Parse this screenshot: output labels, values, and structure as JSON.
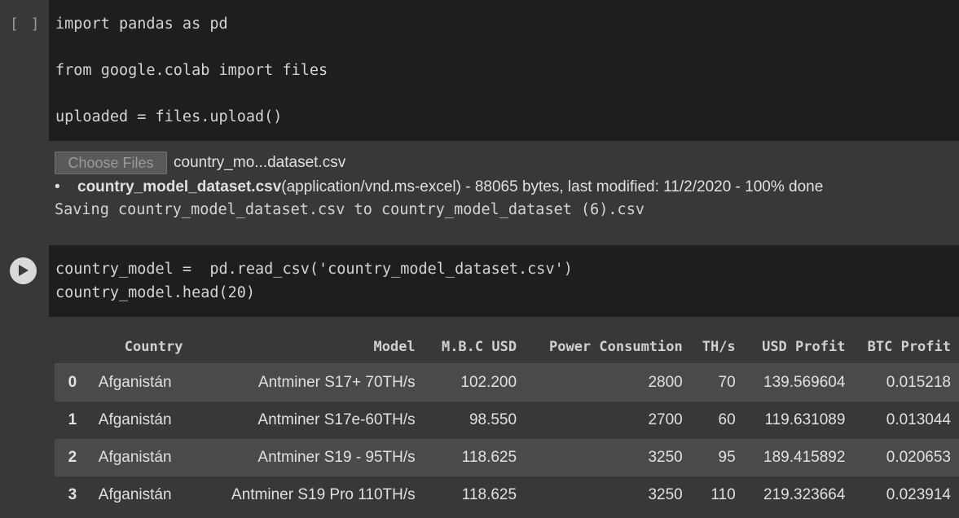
{
  "cell1": {
    "brackets": "[ ]",
    "lines": [
      "import pandas as pd",
      "from google.colab import files",
      "uploaded = files.upload()"
    ]
  },
  "upload_output": {
    "choose_button": "Choose Files",
    "selected_file": "country_mo...dataset.csv",
    "file_name": "country_model_dataset.csv",
    "file_details": "(application/vnd.ms-excel) - 88065 bytes, last modified: 11/2/2020 - 100% done",
    "saving_message": "Saving country_model_dataset.csv to country_model_dataset (6).csv"
  },
  "cell2": {
    "lines": [
      "country_model =  pd.read_csv('country_model_dataset.csv')",
      "country_model.head(20)"
    ]
  },
  "dataframe": {
    "columns": [
      "",
      "Country",
      "Model",
      "M.B.C USD",
      "Power Consumtion",
      "TH/s",
      "USD Profit",
      "BTC Profit"
    ],
    "rows": [
      [
        "0",
        "Afganistán",
        "Antminer S17+ 70TH/s",
        "102.200",
        "2800",
        "70",
        "139.569604",
        "0.015218"
      ],
      [
        "1",
        "Afganistán",
        "Antminer S17e-60TH/s",
        "98.550",
        "2700",
        "60",
        "119.631089",
        "0.013044"
      ],
      [
        "2",
        "Afganistán",
        "Antminer S19 - 95TH/s",
        "118.625",
        "3250",
        "95",
        "189.415892",
        "0.020653"
      ],
      [
        "3",
        "Afganistán",
        "Antminer S19 Pro 110TH/s",
        "118.625",
        "3250",
        "110",
        "219.323664",
        "0.023914"
      ]
    ]
  },
  "icons": {
    "run": "play-icon"
  }
}
